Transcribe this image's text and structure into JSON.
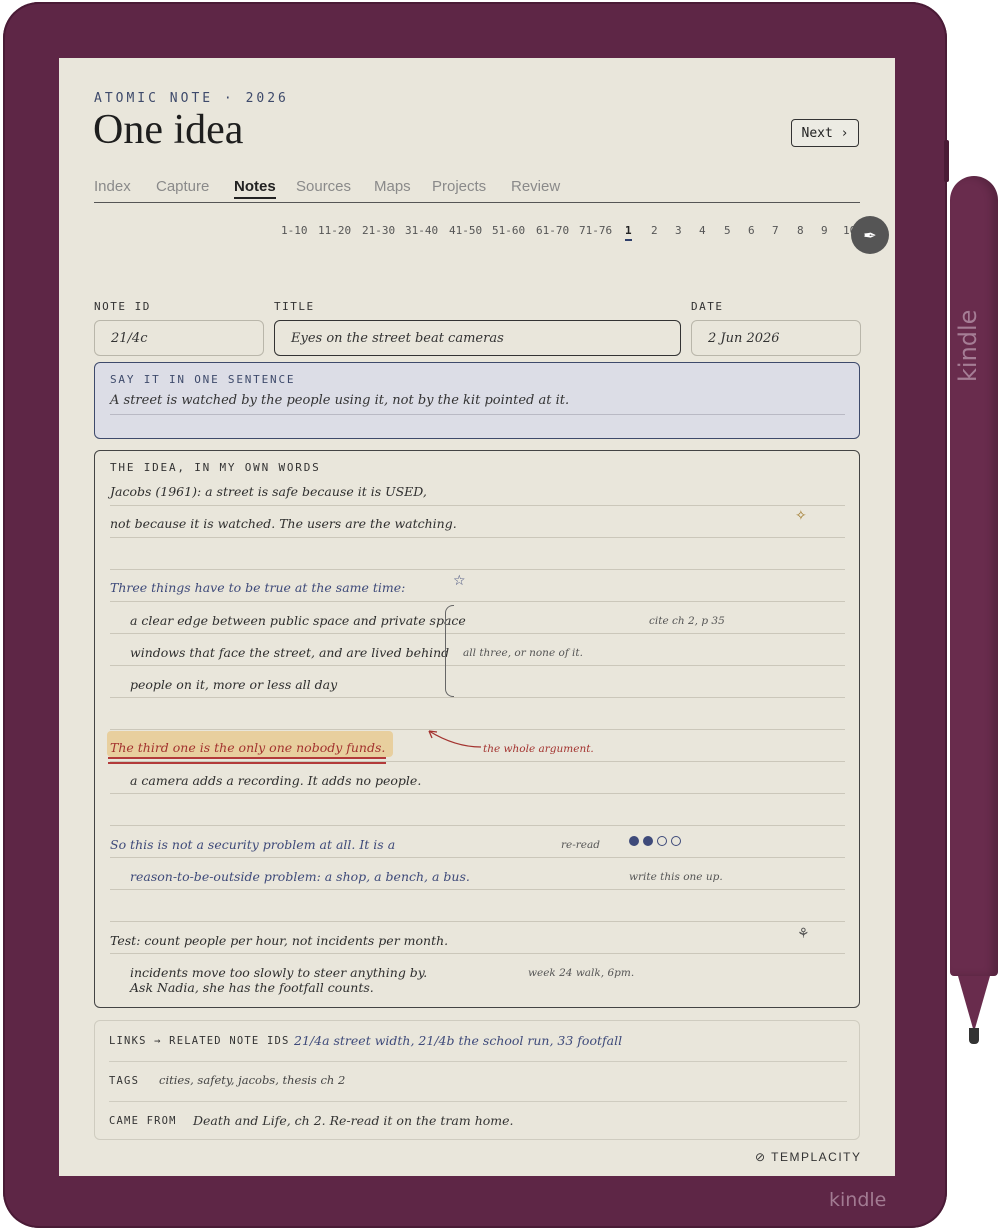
{
  "device": {
    "brand_bottom": "kindle",
    "brand_pen": "kindle"
  },
  "header": {
    "kicker": "ATOMIC NOTE · 2026",
    "title": "One idea",
    "next_label": "Next ›"
  },
  "tabs": [
    "Index",
    "Capture",
    "Notes",
    "Sources",
    "Maps",
    "Projects",
    "Review"
  ],
  "active_tab": "Notes",
  "pager": [
    "1-10",
    "11-20",
    "21-30",
    "31-40",
    "41-50",
    "51-60",
    "61-70",
    "71-76",
    "1",
    "2",
    "3",
    "4",
    "5",
    "6",
    "7",
    "8",
    "9",
    "10"
  ],
  "pager_active": "1",
  "fields": {
    "note_id_label": "NOTE ID",
    "note_id": "21/4c",
    "title_label": "TITLE",
    "title": "Eyes on the street beat cameras",
    "date_label": "DATE",
    "date": "2 Jun 2026"
  },
  "summary": {
    "label": "SAY IT IN ONE SENTENCE",
    "text": "A street is watched by the people using it, not by the kit pointed at it."
  },
  "idea": {
    "label": "THE IDEA, IN MY OWN WORDS",
    "line1": "Jacobs (1961): a street is safe because it is USED,",
    "line2": "not because it is watched. The users are the watching.",
    "line3": "Three things have to be true at the same time:",
    "item1": "a clear edge between public space and private space",
    "item2": "windows that face the street, and are lived behind",
    "item3": "people on it, more or less all day",
    "cite": "cite ch 2, p 35",
    "brace_note": "all three, or none of it.",
    "highlight": "The third one is the only one nobody funds.",
    "arrow_note": "the whole argument.",
    "line4": "a camera adds a recording. It adds no people.",
    "line5": "So this is not a security problem at all. It is a",
    "reread": "re-read",
    "line6": "reason-to-be-outside problem: a shop, a bench, a bus.",
    "write_up": "write this one up.",
    "line7": "Test: count people per hour, not incidents per month.",
    "line8": "incidents move too slowly to steer anything by.",
    "walk": "week 24 walk, 6pm.",
    "line9": "Ask Nadia, she has the footfall counts.",
    "dots_filled": 2,
    "dots_total": 4
  },
  "meta": {
    "links_label": "LINKS → RELATED NOTE IDS",
    "links": "21/4a street width, 21/4b the school run, 33 footfall",
    "tags_label": "TAGS",
    "tags": "cities, safety, jacobs, thesis ch 2",
    "from_label": "CAME FROM",
    "from": "Death and Life, ch 2. Re-read it on the tram home."
  },
  "credit": "TEMPLACITY",
  "colors": {
    "device": "#5e2646",
    "screen": "#e9e6db",
    "ink_blue": "#3e4a7a",
    "ink_red": "#a3332f",
    "highlight": "#e8cf9e"
  }
}
